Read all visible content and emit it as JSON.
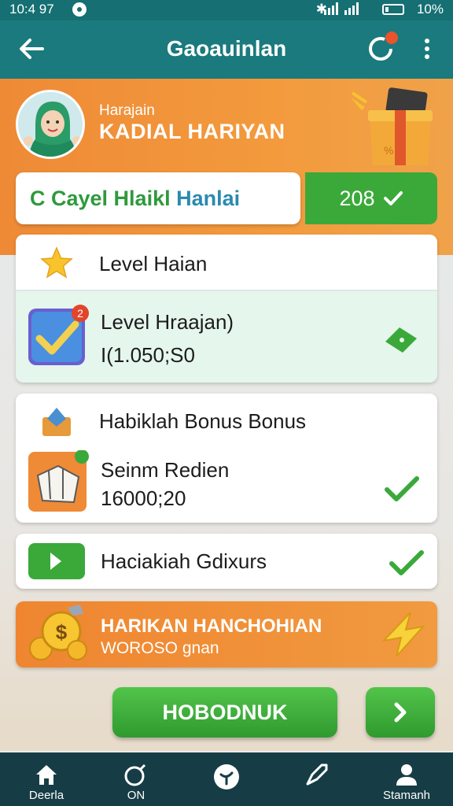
{
  "status_bar": {
    "time": "10:4 97",
    "battery": "10%"
  },
  "app_bar": {
    "title": "Gaoauinlan"
  },
  "hero": {
    "subtitle": "Harajain",
    "title": "KADIAL HARIYAN"
  },
  "tabs": {
    "left_part1": "C Cayel Hlaikl",
    "left_part2": "Hanlai",
    "count": "208"
  },
  "main_card": {
    "row1_label": "Level Haian",
    "row2_label": "Level Hraajan)",
    "row2_value": "I(1.050;S0",
    "row2_badge": "2"
  },
  "bonus_card": {
    "header_label": "Habiklah Bonus Bonus",
    "item_label": "Seinm Redien",
    "item_value": "16000;20"
  },
  "bonus_row": {
    "label": "Haciakiah Gdixurs"
  },
  "banner": {
    "title": "HARIKAN HANCHOHIAN",
    "subtitle": "WOROSO gnan"
  },
  "actions": {
    "primary_label": "HOBODNUK"
  },
  "bottom_nav": [
    {
      "label": "Deerla",
      "icon": "home-icon"
    },
    {
      "label": "ON",
      "icon": "bomb-icon"
    },
    {
      "label": "",
      "icon": "compass-icon"
    },
    {
      "label": "",
      "icon": "rocket-icon"
    },
    {
      "label": "Stamanh",
      "icon": "profile-icon"
    }
  ],
  "colors": {
    "teal": "#1b7a7d",
    "orange": "#ef8a36",
    "green": "#3aa93a",
    "nav": "#163d45"
  }
}
